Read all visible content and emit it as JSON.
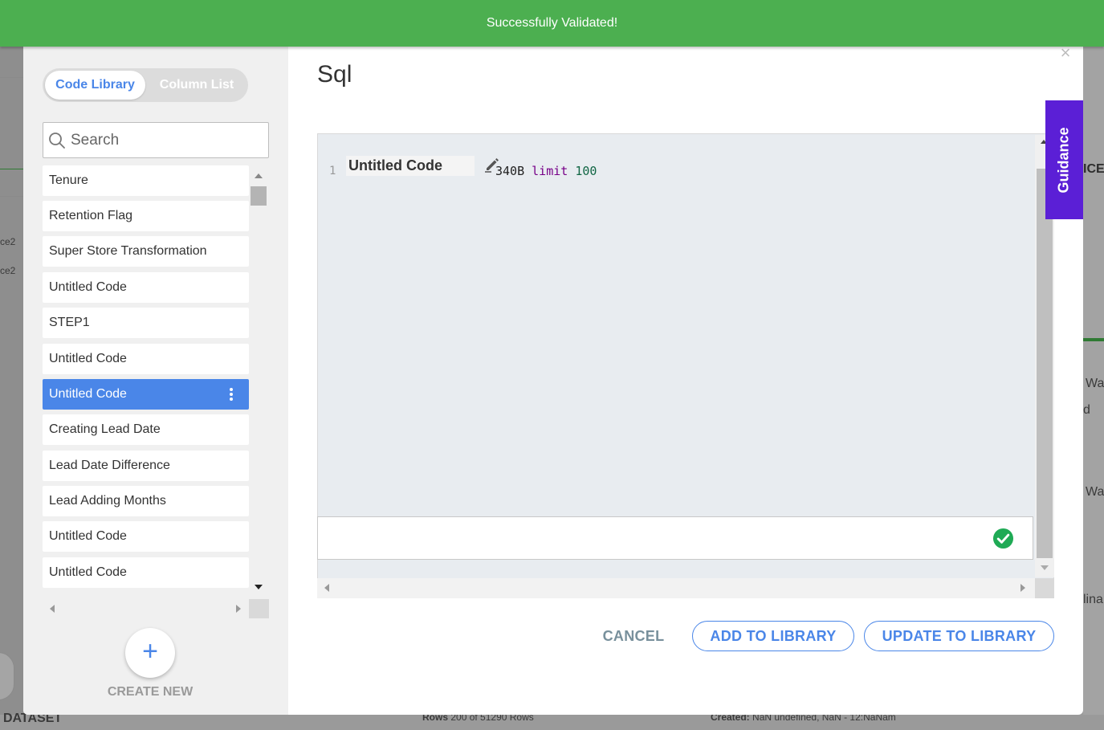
{
  "banner": {
    "message": "Successfully Validated!"
  },
  "background": {
    "left_fragments": [
      "ce2",
      "ce2"
    ],
    "right_fragments": [
      "ICE",
      "Wa",
      "d",
      "Wa",
      "lina"
    ],
    "bottom_left": "DATASET",
    "rows_label": "Rows",
    "rows_value": "200 of 51290 Rows",
    "created_label": "Created:",
    "created_value": "NaN undefined, NaN - 12:NaNam"
  },
  "left_panel": {
    "tabs": [
      {
        "label": "Code Library",
        "active": true
      },
      {
        "label": "Column List",
        "active": false
      }
    ],
    "search": {
      "placeholder": "Search",
      "value": ""
    },
    "items": [
      {
        "label": "Tenure"
      },
      {
        "label": "Retention Flag"
      },
      {
        "label": "Super Store Transformation"
      },
      {
        "label": "Untitled Code"
      },
      {
        "label": "STEP1"
      },
      {
        "label": "Untitled Code"
      },
      {
        "label": "Untitled Code",
        "selected": true
      },
      {
        "label": "Creating Lead Date"
      },
      {
        "label": "Lead Date Difference"
      },
      {
        "label": "Lead Adding Months"
      },
      {
        "label": "Untitled Code"
      },
      {
        "label": "Untitled Code"
      }
    ],
    "create": {
      "icon": "+",
      "label": "CREATE NEW"
    }
  },
  "dialog": {
    "title": "Sql",
    "close_icon": "×",
    "editor": {
      "line_number": "1",
      "code_name": "Untitled Code",
      "code_prefix": "340B ",
      "keyword": "limit",
      "number": "100"
    },
    "buttons": {
      "cancel": "CANCEL",
      "add": "ADD TO LIBRARY",
      "update": "UPDATE TO LIBRARY"
    },
    "guidance": "Guidance"
  },
  "colors": {
    "success": "#4caf50",
    "primary": "#4a86e8",
    "guidance": "#5b1fd6",
    "check": "#1faa55"
  }
}
